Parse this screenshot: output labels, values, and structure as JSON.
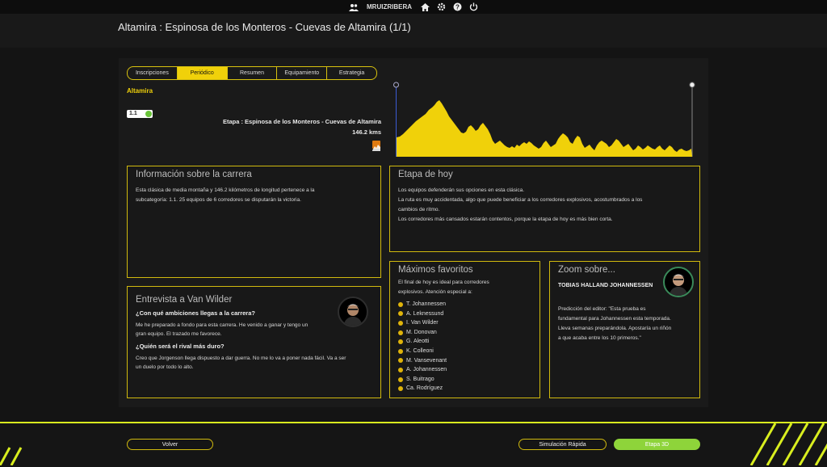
{
  "topbar": {
    "username": "MRUIZRIBERA",
    "icons": [
      "users-icon",
      "home-icon",
      "gear-icon",
      "help-icon",
      "power-icon"
    ]
  },
  "header": {
    "title": "Altamira : Espinosa de los Monteros - Cuevas de Altamira (1/1)"
  },
  "tabs": [
    {
      "label": "Inscripciones",
      "active": false
    },
    {
      "label": "Periódico",
      "active": true
    },
    {
      "label": "Resumen",
      "active": false
    },
    {
      "label": "Equipamiento",
      "active": false
    },
    {
      "label": "Estrategia",
      "active": false
    }
  ],
  "race": {
    "name": "Altamira",
    "category": "1.1",
    "stage_label": "Etapa : Espinosa de los Monteros - Cuevas de Altamira",
    "distance": "146.2 kms"
  },
  "info": {
    "title": "Información sobre la carrera",
    "lines": [
      "Esta clásica de media montaña y 146.2 kilómetros de longitud pertenece a la",
      "subcategoría: 1.1. 25 equipos de 6 corredores se disputarán la victoria."
    ]
  },
  "etapa": {
    "title": "Etapa de hoy",
    "lines": [
      "Los equipos defenderán sus opciones en esta clásica.",
      "La ruta es muy accidentada, algo que puede beneficiar a los corredores explosivos, acostumbrados a los",
      "cambios de ritmo.",
      "Los corredores más cansados estarán contentos, porque la etapa de hoy es más bien corta."
    ]
  },
  "interview": {
    "title": "Entrevista a Van Wilder",
    "q1": "¿Con qué ambiciones llegas a la carrera?",
    "a1": [
      "Me he preparado a fondo para esta carrera. He venido a ganar y tengo un",
      "gran equipo. El trazado me favorece."
    ],
    "q2": "¿Quién será el rival más duro?",
    "a2": [
      "Creo que Jorgenson llega dispuesto a dar guerra. No me lo va a poner nada fácil. Va a ser",
      "un duelo por todo lo alto."
    ]
  },
  "favoritos": {
    "title": "Máximos favoritos",
    "intro": [
      "El final de hoy es ideal para corredores",
      "explosivos. Atención especial a:"
    ],
    "riders": [
      "T. Johannessen",
      "A. Leknessund",
      "I. Van Wilder",
      "M. Donovan",
      "G. Aleotti",
      "K. Colleoni",
      "M. Vansevenant",
      "A. Johannessen",
      "S. Buitrago",
      "Ca. Rodríguez"
    ]
  },
  "zoom": {
    "title": "Zoom sobre...",
    "rider": "TOBIAS HALLAND JOHANNESSEN",
    "lines": [
      "Predicción del editor:  \"Esta prueba es",
      "fundamental para Johannessen esta temporada.",
      "Lleva semanas preparándola. Apostaría un riñón",
      "a que acaba entre los 10 primeros.\""
    ]
  },
  "buttons": {
    "back": "Volver",
    "quick_sim": "Simulación Rápida",
    "stage_3d": "Etapa 3D"
  },
  "colors": {
    "accent": "#f0d10a",
    "green": "#8ed43a",
    "lime": "#d9ee1f"
  }
}
